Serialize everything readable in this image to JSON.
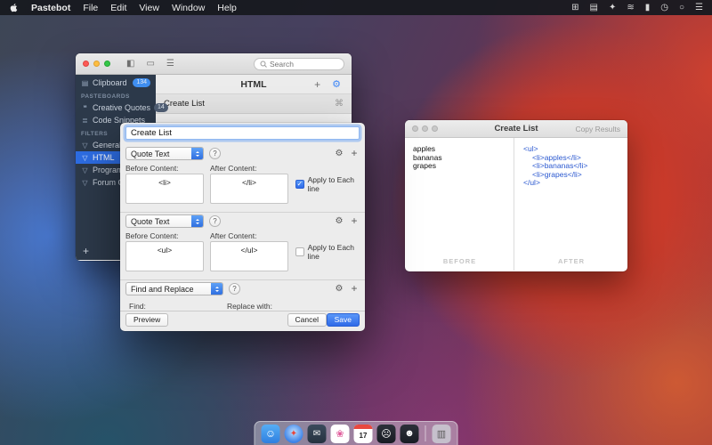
{
  "menu_bar": {
    "app_name": "Pastebot",
    "menus": [
      "File",
      "Edit",
      "View",
      "Window",
      "Help"
    ],
    "status_icons": [
      {
        "name": "grid",
        "glyph": "⊞"
      },
      {
        "name": "display",
        "glyph": "▤"
      },
      {
        "name": "dropbox",
        "glyph": "✦"
      },
      {
        "name": "wifi",
        "glyph": "≋"
      },
      {
        "name": "battery",
        "glyph": "▮"
      },
      {
        "name": "clock",
        "glyph": "◷"
      },
      {
        "name": "spotlight",
        "glyph": "○"
      },
      {
        "name": "notification-center",
        "glyph": "☰"
      }
    ]
  },
  "main_window": {
    "search_placeholder": "Search",
    "toolbar_icons": [
      {
        "name": "sidebar-toggle",
        "glyph": "◧"
      },
      {
        "name": "layout-view",
        "glyph": "▭"
      },
      {
        "name": "list-view",
        "glyph": "☰"
      }
    ],
    "sidebar": {
      "clipboard": {
        "label": "Clipboard",
        "badge": "134",
        "icon": "▤"
      },
      "pasteboards_header": "PASTEBOARDS",
      "pasteboards": [
        {
          "label": "Creative Quotes",
          "badge": "14",
          "icon": "❝"
        },
        {
          "label": "Code Snippets",
          "icon": "≣"
        }
      ],
      "filters_header": "FILTERS",
      "filters": [
        {
          "label": "General",
          "icon": "▽"
        },
        {
          "label": "HTML",
          "icon": "▽"
        },
        {
          "label": "Programming",
          "icon": "▽"
        },
        {
          "label": "Forum Code",
          "icon": "▽"
        }
      ],
      "add_label": "+"
    },
    "content": {
      "title": "HTML",
      "add_label": "+",
      "gear_glyph": "⚙",
      "row": {
        "label": "Create List",
        "shortcut": "⌘"
      }
    }
  },
  "filter_dialog": {
    "name_value": "Create List",
    "checkmark": "✓",
    "gear_glyph": "⚙",
    "plus_label": "+",
    "help_label": "?",
    "steps": [
      {
        "type_label": "Quote Text",
        "before_label": "Before Content:",
        "before_value": "<li>",
        "after_label": "After Content:",
        "after_value": "</li>",
        "checkbox_label": "Apply to Each line"
      },
      {
        "type_label": "Quote Text",
        "before_label": "Before Content:",
        "before_value": "<ul>",
        "after_label": "After Content:",
        "after_value": "</ul>",
        "checkbox_label": "Apply to Each line"
      },
      {
        "type_label": "Find and Replace",
        "find_label": "Find:",
        "replace_label": "Replace with:"
      }
    ],
    "preview_label": "Preview",
    "cancel_label": "Cancel",
    "save_label": "Save"
  },
  "preview_window": {
    "title": "Create List",
    "copy_results_label": "Copy Results",
    "before_lines": [
      "apples",
      "bananas",
      "grapes"
    ],
    "after_lines": [
      "<ul>",
      "<li>apples</li>",
      "<li>bananas</li>",
      "<li>grapes</li>",
      "</ul>"
    ],
    "before_caption": "BEFORE",
    "after_caption": "AFTER"
  },
  "dock": {
    "items": [
      {
        "name": "finder",
        "glyph": "☺"
      },
      {
        "name": "safari",
        "glyph": "✦"
      },
      {
        "name": "mail",
        "glyph": "✉"
      },
      {
        "name": "photos",
        "glyph": "❀"
      },
      {
        "name": "calendar",
        "date": "17"
      },
      {
        "name": "screaming-face",
        "glyph": "☹"
      },
      {
        "name": "pastebot-robot",
        "glyph": "☻"
      },
      {
        "name": "trash",
        "glyph": "▥"
      }
    ]
  }
}
